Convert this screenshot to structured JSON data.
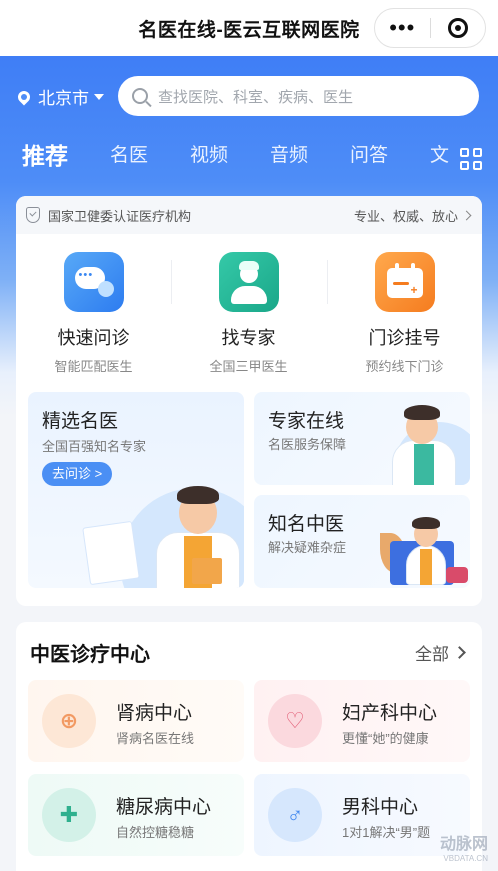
{
  "topbar": {
    "title": "名医在线-医云互联网医院",
    "more_glyph": "•••"
  },
  "location": {
    "city": "北京市"
  },
  "search": {
    "placeholder": "查找医院、科室、疾病、医生"
  },
  "tabs": [
    {
      "label": "推荐",
      "active": true
    },
    {
      "label": "名医"
    },
    {
      "label": "视频"
    },
    {
      "label": "音频"
    },
    {
      "label": "问答"
    },
    {
      "label": "文"
    }
  ],
  "cert": {
    "left": "国家卫健委认证医疗机构",
    "right": "专业、权威、放心"
  },
  "services": [
    {
      "name": "快速问诊",
      "sub": "智能匹配医生",
      "icon": "chat-bubbles-icon"
    },
    {
      "name": "找专家",
      "sub": "全国三甲医生",
      "icon": "doctor-icon"
    },
    {
      "name": "门诊挂号",
      "sub": "预约线下门诊",
      "icon": "calendar-icon"
    }
  ],
  "features": {
    "big": {
      "title": "精选名医",
      "sub": "全国百强知名专家",
      "button": "去问诊 >"
    },
    "small1": {
      "title": "专家在线",
      "sub": "名医服务保障"
    },
    "small2": {
      "title": "知名中医",
      "sub": "解决疑难杂症"
    }
  },
  "tcm": {
    "title": "中医诊疗中心",
    "all": "全部",
    "centers": [
      {
        "name": "肾病中心",
        "sub": "肾病名医在线",
        "icon": "medkit-icon",
        "glyph": "⊕",
        "color": "#f29a63"
      },
      {
        "name": "妇产科中心",
        "sub": "更懂“她”的健康",
        "icon": "uterus-icon",
        "glyph": "♡",
        "color": "#e25b74"
      },
      {
        "name": "糖尿病中心",
        "sub": "自然控糖稳糖",
        "icon": "blood-drop-icon",
        "glyph": "✚",
        "color": "#2fb08e"
      },
      {
        "name": "男科中心",
        "sub": "1对1解决“男”题",
        "icon": "sperm-icon",
        "glyph": "♂",
        "color": "#3f86ee"
      }
    ]
  },
  "watermark": {
    "brand": "动脉网",
    "url": "VBDATA.CN"
  }
}
